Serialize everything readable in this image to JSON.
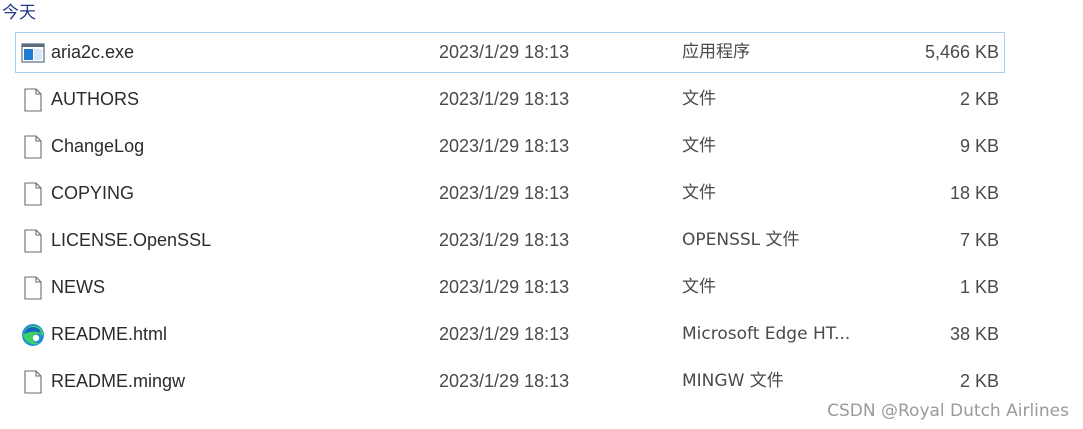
{
  "group": {
    "label": "今天"
  },
  "files": [
    {
      "name": "aria2c.exe",
      "date": "2023/1/29 18:13",
      "type": "应用程序",
      "size": "5,466 KB",
      "icon": "exe-icon"
    },
    {
      "name": "AUTHORS",
      "date": "2023/1/29 18:13",
      "type": "文件",
      "size": "2 KB",
      "icon": "file-icon"
    },
    {
      "name": "ChangeLog",
      "date": "2023/1/29 18:13",
      "type": "文件",
      "size": "9 KB",
      "icon": "file-icon"
    },
    {
      "name": "COPYING",
      "date": "2023/1/29 18:13",
      "type": "文件",
      "size": "18 KB",
      "icon": "file-icon"
    },
    {
      "name": "LICENSE.OpenSSL",
      "date": "2023/1/29 18:13",
      "type": "OPENSSL 文件",
      "size": "7 KB",
      "icon": "file-icon"
    },
    {
      "name": "NEWS",
      "date": "2023/1/29 18:13",
      "type": "文件",
      "size": "1 KB",
      "icon": "file-icon"
    },
    {
      "name": "README.html",
      "date": "2023/1/29 18:13",
      "type": "Microsoft Edge HT...",
      "size": "38 KB",
      "icon": "edge-icon"
    },
    {
      "name": "README.mingw",
      "date": "2023/1/29 18:13",
      "type": "MINGW 文件",
      "size": "2 KB",
      "icon": "file-icon"
    }
  ],
  "watermark": "CSDN @Royal Dutch Airlines",
  "colors": {
    "selection_border": "#a9cdf0",
    "group_header": "#1e3a8a"
  }
}
